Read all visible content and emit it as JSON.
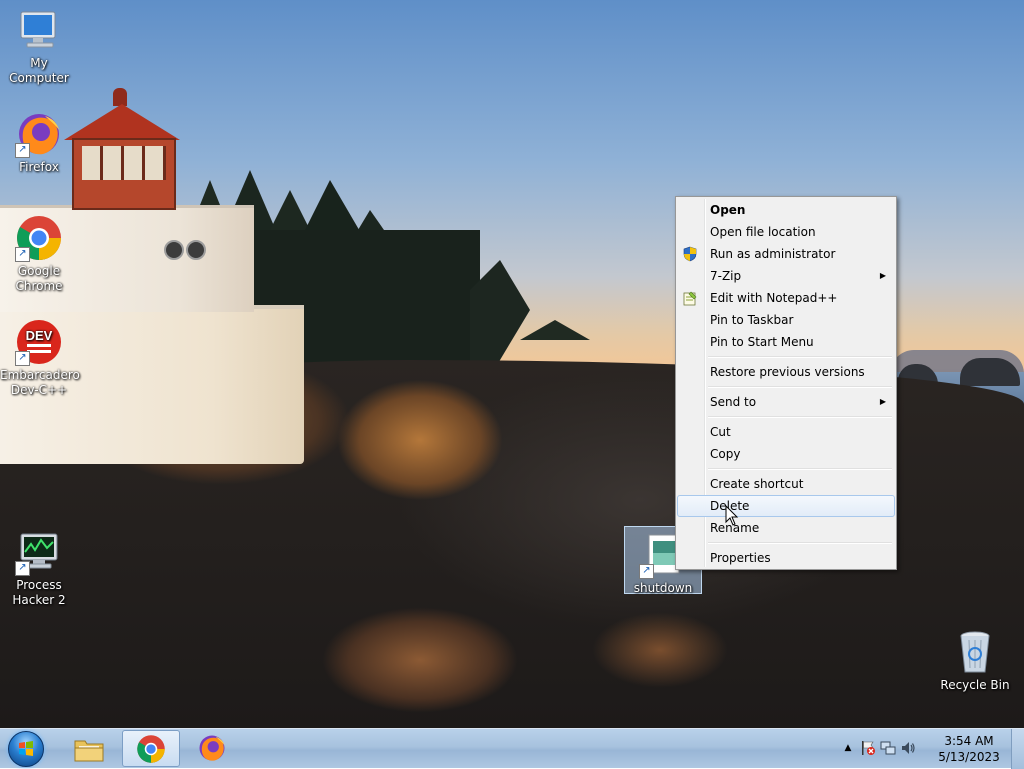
{
  "desktop": {
    "icons": [
      {
        "label": "My Computer",
        "icon": "computer-icon"
      },
      {
        "label": "Firefox",
        "icon": "firefox-icon"
      },
      {
        "label": "Google Chrome",
        "icon": "chrome-icon"
      },
      {
        "label": "Embarcadero Dev-C++",
        "icon": "devcpp-icon",
        "logo_text": "DEV"
      },
      {
        "label": "Process Hacker 2",
        "icon": "process-hacker-icon"
      },
      {
        "label": "shutdown",
        "icon": "shutdown-shortcut-icon",
        "selected": true
      },
      {
        "label": "Recycle Bin",
        "icon": "recycle-bin-icon"
      }
    ]
  },
  "context_menu": {
    "items": [
      {
        "label": "Open",
        "bold": true
      },
      {
        "label": "Open file location"
      },
      {
        "label": "Run as administrator",
        "icon": "uac-shield-icon"
      },
      {
        "label": "7-Zip",
        "submenu": true
      },
      {
        "label": "Edit with Notepad++",
        "icon": "notepadpp-icon"
      },
      {
        "label": "Pin to Taskbar"
      },
      {
        "label": "Pin to Start Menu"
      },
      {
        "label": "Restore previous versions"
      },
      {
        "label": "Send to",
        "submenu": true
      },
      {
        "label": "Cut"
      },
      {
        "label": "Copy"
      },
      {
        "label": "Create shortcut"
      },
      {
        "label": "Delete",
        "hovered": true
      },
      {
        "label": "Rename"
      },
      {
        "label": "Properties"
      }
    ]
  },
  "taskbar": {
    "pinned": [
      {
        "name": "windows-explorer",
        "icon": "folder-icon"
      },
      {
        "name": "google-chrome",
        "icon": "chrome-icon",
        "active": true
      },
      {
        "name": "firefox",
        "icon": "firefox-icon"
      }
    ],
    "tray": {
      "time": "3:54 AM",
      "date": "5/13/2023"
    }
  },
  "colors": {
    "menu_bg": "#f0f0f0",
    "menu_hover_border": "#a8c8ec",
    "taskbar": "#a7c2de",
    "accent": "#2a7fd1"
  }
}
